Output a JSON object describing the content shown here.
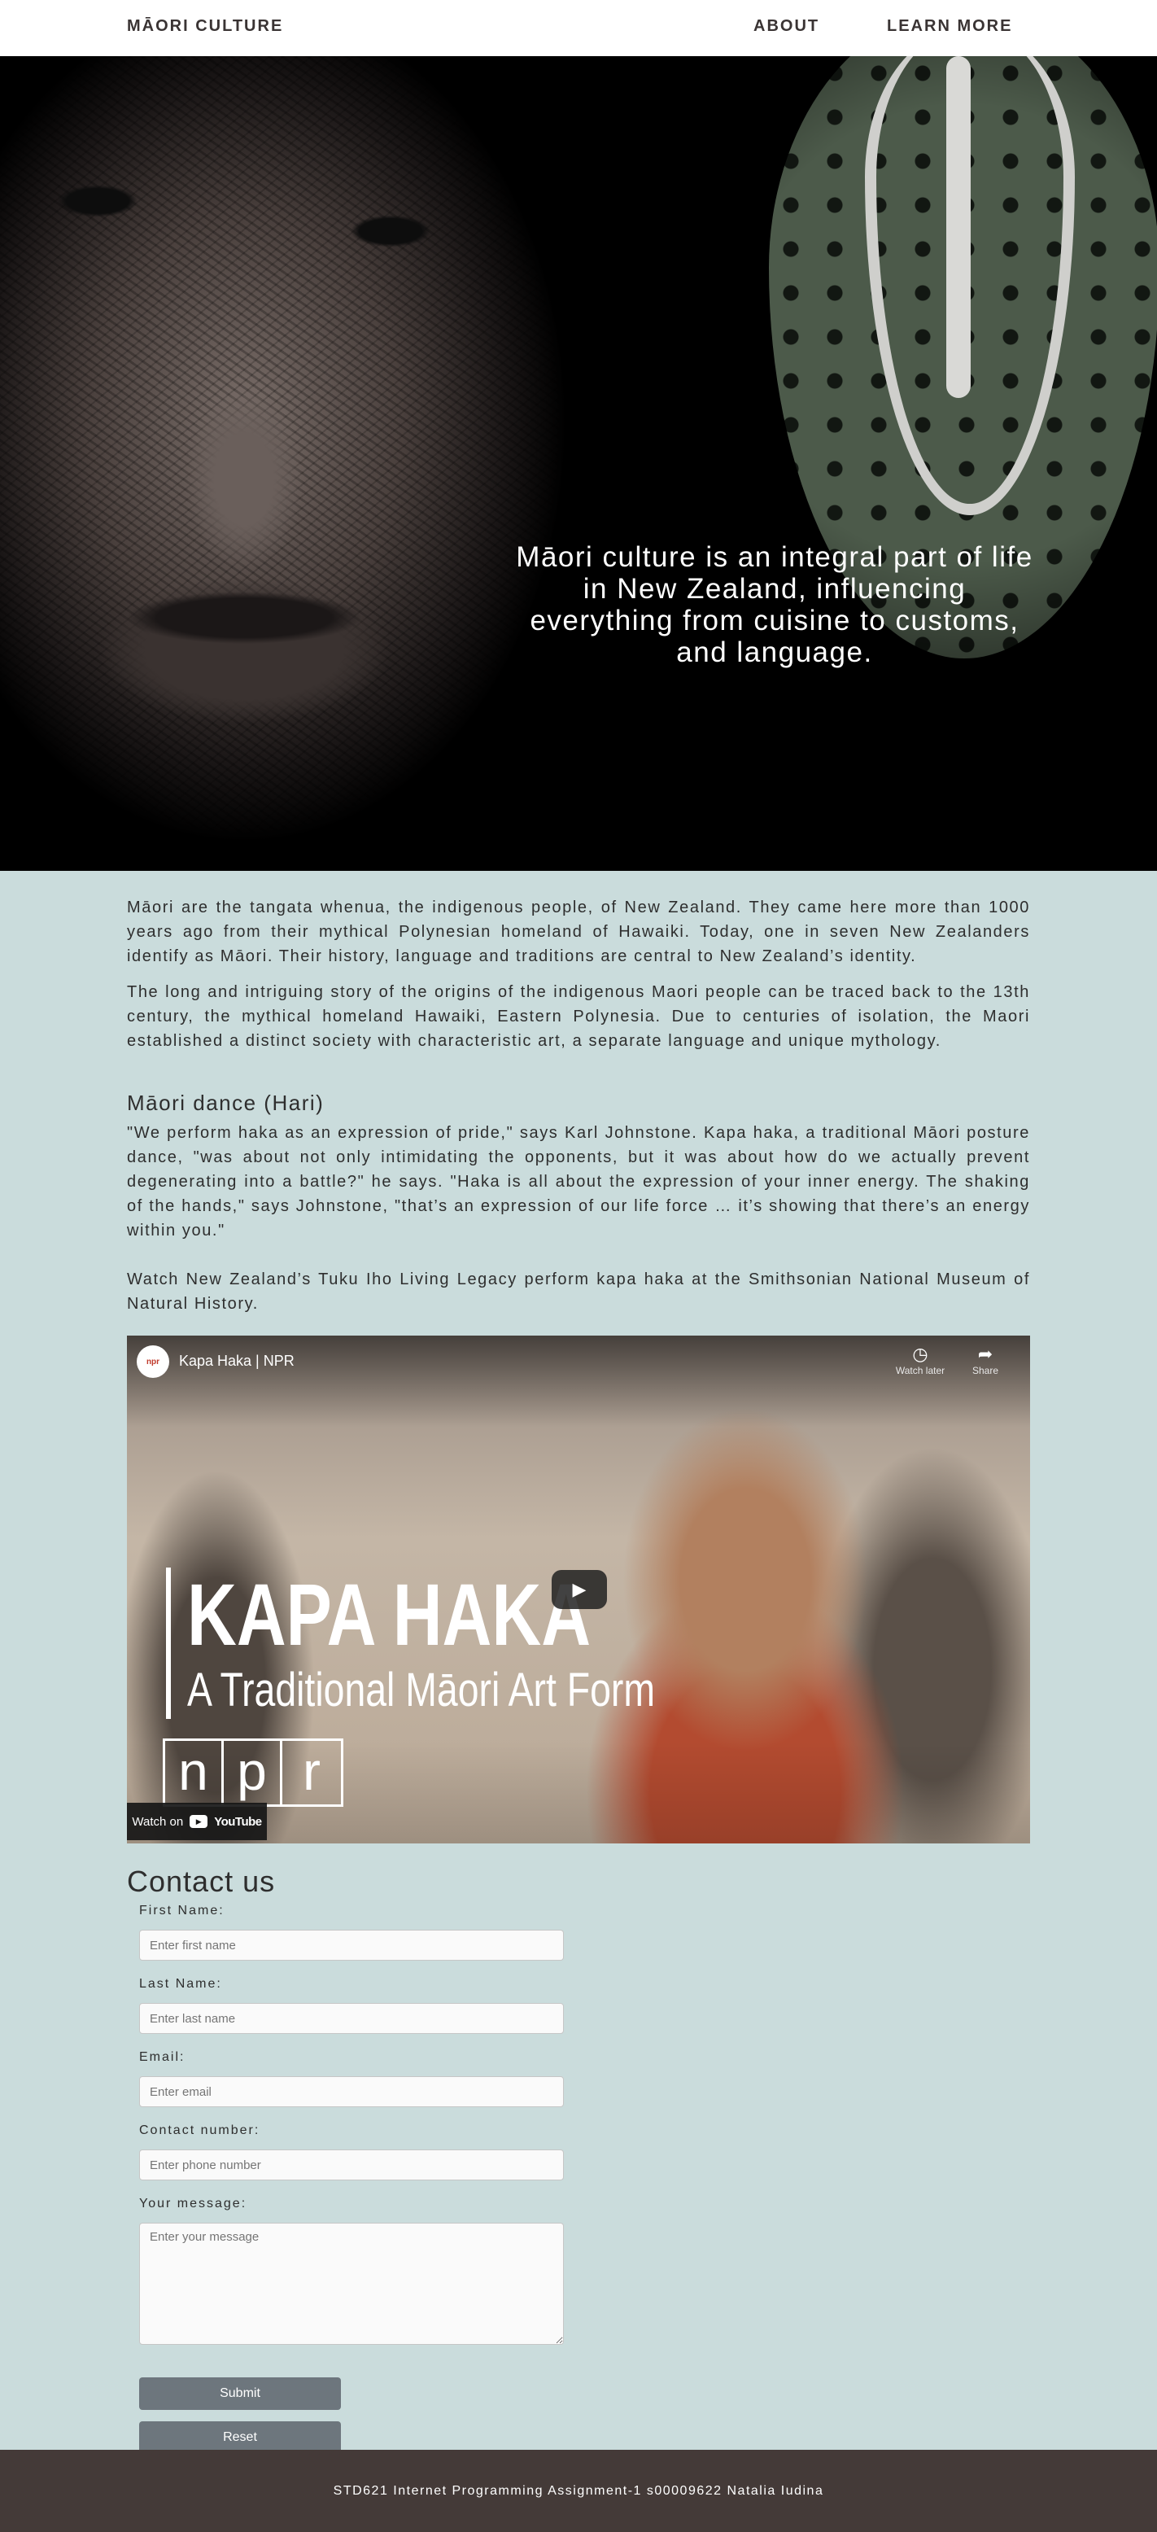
{
  "nav": {
    "brand": "MĀORI CULTURE",
    "links": [
      "ABOUT",
      "LEARN MORE"
    ]
  },
  "hero": {
    "headline": "Māori culture is an integral part of life in New Zealand, influencing everything from cuisine to customs, and language."
  },
  "intro": {
    "paragraphs": [
      "Māori are the tangata whenua, the indigenous people, of New Zealand. They came here more than 1000 years ago from their mythical Polynesian homeland of Hawaiki. Today, one in seven New Zealanders identify as Māori. Their history, language and traditions are central to New Zealand’s identity.",
      "The long and intriguing story of the origins of the indigenous Maori people can be traced back to the 13th century, the mythical homeland Hawaiki, Eastern Polynesia. Due to centuries of isolation, the Maori established a distinct society with characteristic art, a separate language and unique mythology."
    ]
  },
  "dance": {
    "title": "Māori dance (Hari)",
    "quote": "\"We perform haka as an expression of pride,\" says Karl Johnstone. Kapa haka, a traditional Māori posture dance, \"was about not only intimidating the opponents, but it was about how do we actually prevent degenerating into a battle?\" he says. \"Haka is all about the expression of your inner energy. The shaking of the hands,\" says Johnstone, \"that’s an expression of our life force … it’s showing that there’s an energy within you.\"",
    "watch_text": "Watch New Zealand’s Tuku Iho Living Legacy perform kapa haka at the Smithsonian National Museum of Natural History."
  },
  "video": {
    "channel_badge": "npr",
    "title": "Kapa Haka | NPR",
    "watch_later": "Watch later",
    "share": "Share",
    "headline_main": "KAPA HAKA",
    "headline_sub": "A Traditional Māori Art Form",
    "npr_letters": [
      "n",
      "p",
      "r"
    ],
    "watch_on": "Watch on",
    "youtube_word": "YouTube",
    "icons": {
      "watch_later": "clock-icon",
      "share": "share-arrow-icon",
      "play": "play-icon",
      "youtube": "youtube-logo-icon"
    }
  },
  "contact": {
    "title": "Contact us",
    "fields": {
      "first_name": {
        "label": "First Name:",
        "placeholder": "Enter first name"
      },
      "last_name": {
        "label": "Last Name:",
        "placeholder": "Enter last name"
      },
      "email": {
        "label": "Email:",
        "placeholder": "Enter email"
      },
      "phone": {
        "label": "Contact number:",
        "placeholder": "Enter phone number"
      },
      "message": {
        "label": "Your message:",
        "placeholder": "Enter your message"
      }
    },
    "submit_label": "Submit",
    "reset_label": "Reset"
  },
  "footer": {
    "text": "STD621 Internet Programming Assignment-1 s00009622 Natalia Iudina"
  },
  "colors": {
    "nav_background": "#ffffff",
    "page_background": "#cadcdc",
    "text": "#2e2e2e",
    "button": "#6d767d",
    "footer_background": "#443a38"
  }
}
